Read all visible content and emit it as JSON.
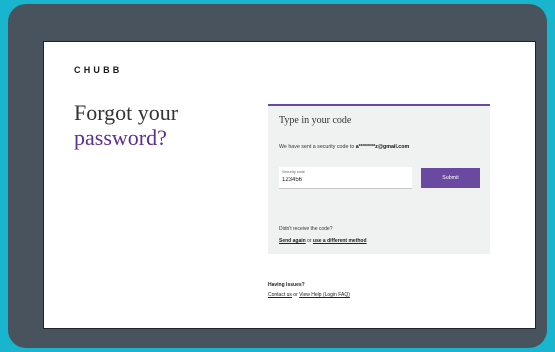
{
  "brand": {
    "logo_text": "CHUBB"
  },
  "heading": {
    "line1": "Forgot your",
    "line2": "password?"
  },
  "colors": {
    "accent": "#6a4aa0",
    "heading_accent": "#5c2e91",
    "background": "#19b4ce",
    "device": "#48535e"
  },
  "card": {
    "title": "Type in your code",
    "message_prefix": "We have sent a security code to ",
    "message_email": "a********z@gmail.com",
    "field_label": "Security code",
    "field_value": "123456",
    "submit_label": "Submit",
    "no_code_text": "Didn't receive the code?",
    "send_again": "Send again",
    "or_text": "or",
    "different_method": "use a different method"
  },
  "issues": {
    "title": "Having Issues?",
    "contact": "Contact us",
    "or_text": "or",
    "help": "View Help (Login FAQ)"
  }
}
